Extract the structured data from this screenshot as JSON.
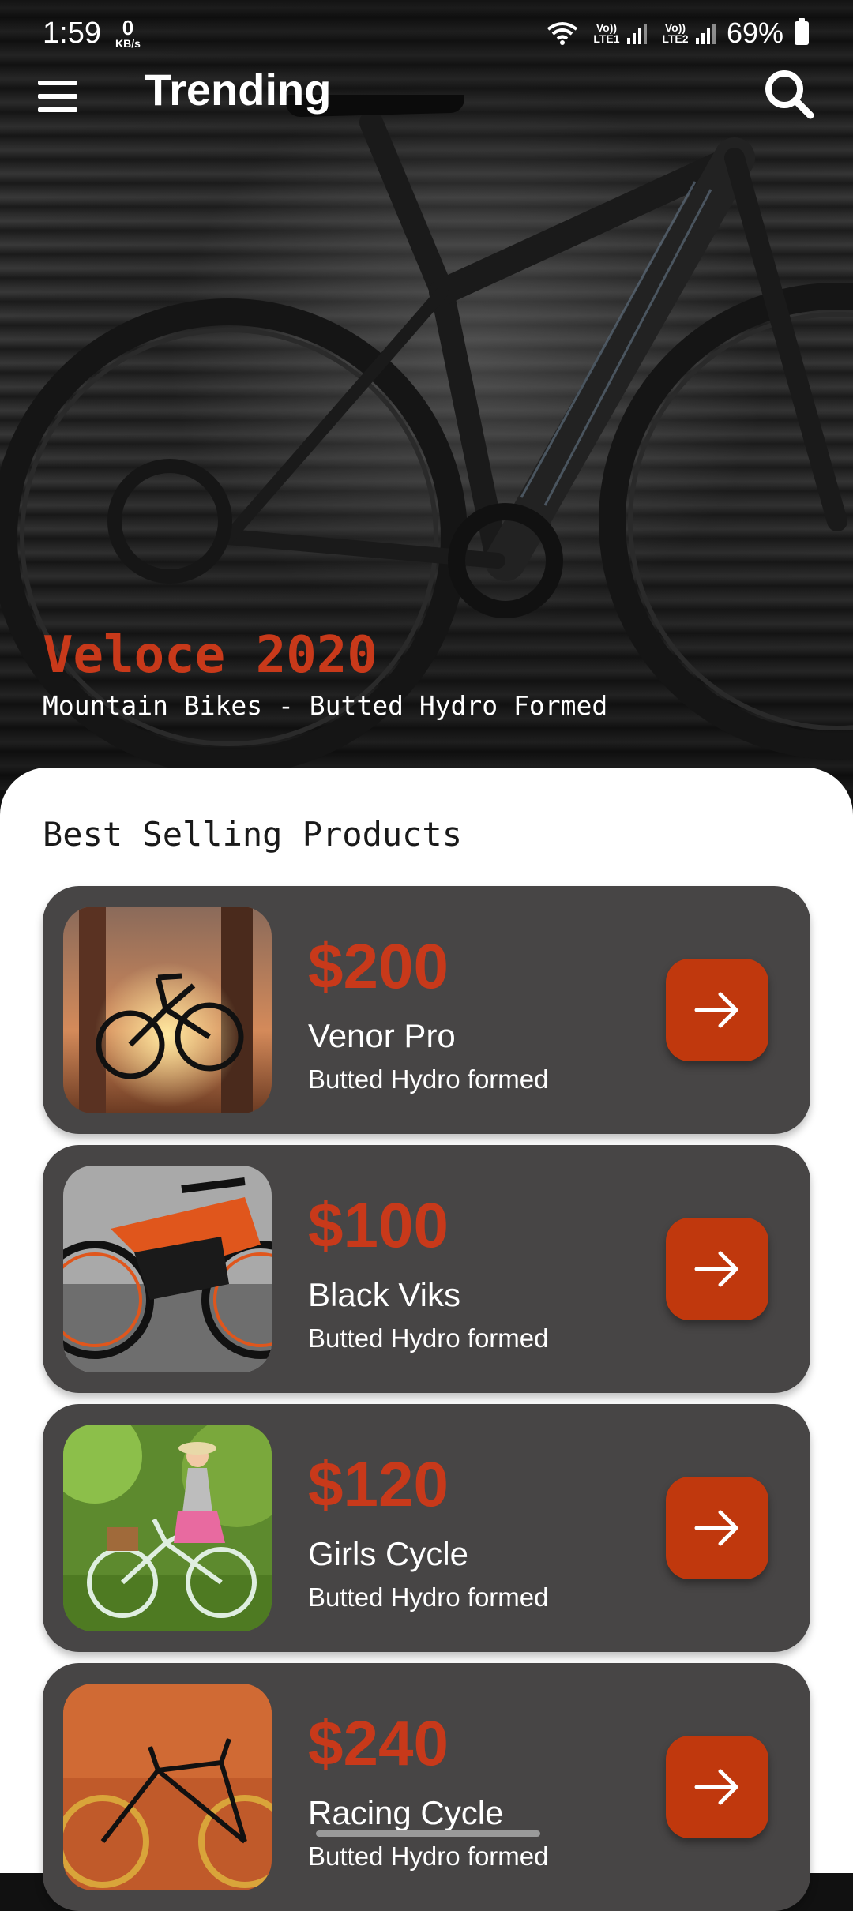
{
  "status_bar": {
    "time": "1:59",
    "data_rate_value": "0",
    "data_rate_unit": "KB/s",
    "sim1_label": "Vo)) LTE1",
    "sim2_label": "Vo)) LTE2",
    "battery_percent": "69%",
    "icons": [
      "wifi-icon",
      "signal-icon",
      "signal-icon",
      "battery-icon"
    ]
  },
  "app_bar": {
    "title": "Trending",
    "menu_icon": "hamburger-menu-icon",
    "search_icon": "search-icon"
  },
  "hero": {
    "name": "Veloce 2020",
    "subtitle": "Mountain Bikes - Butted Hydro Formed"
  },
  "products": {
    "section_title": "Best Selling Products",
    "items": [
      {
        "price": "$200",
        "name": "Venor Pro",
        "desc": "Butted Hydro formed",
        "image": "bike-at-sunset-photo"
      },
      {
        "price": "$100",
        "name": "Black Viks",
        "desc": "Butted Hydro formed",
        "image": "orange-concept-bike-photo"
      },
      {
        "price": "$120",
        "name": "Girls Cycle",
        "desc": "Butted Hydro formed",
        "image": "girl-riding-cycle-photo"
      },
      {
        "price": "$240",
        "name": "Racing Cycle",
        "desc": "Butted Hydro formed",
        "image": "racing-bike-orange-wall-photo"
      }
    ],
    "action_icon": "arrow-right-icon"
  },
  "colors": {
    "accent": "#c8391a",
    "card": "#474545",
    "button": "#c0380d"
  }
}
